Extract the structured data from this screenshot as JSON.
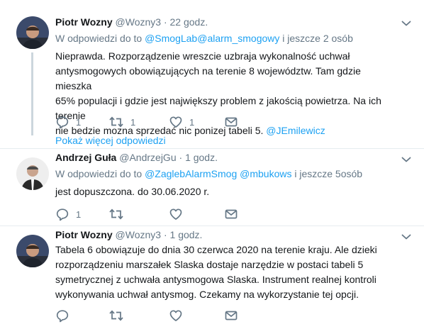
{
  "tweets": [
    {
      "name": "Piotr Wozny",
      "handle": "@Wozny3",
      "sep": "·",
      "time": "22 godz.",
      "reply_prefix": "W odpowiedzi do to ",
      "reply_mention1": "@SmogLab",
      "reply_mention2": "@alarm_smogowy",
      "reply_suffix": " i jeszcze 2 osób",
      "text_line1": "Nieprawda. Rozporządzenie wreszcie uzbraja wykonalność uchwał",
      "text_line2": "antysmogowych obowiązujących na terenie 8 województw. Tam gdzie mieszka",
      "text_line3": "65% populacji i gdzie jest największy problem z jakością powietrza. Na ich terenie",
      "text_line4": "nie bedzie mozna sprzedać nic ponizej tabeli 5. ",
      "text_mention": "@JEmilewicz",
      "reply_count": "1",
      "retweet_count": "1",
      "like_count": "1"
    },
    {
      "name": "Andrzej Guła",
      "handle": "@AndrzejGu",
      "sep": "·",
      "time": "1 godz.",
      "reply_prefix": "W odpowiedzi do to ",
      "reply_mention1": "@ZaglebAlarmSmog",
      "reply_mention2": " @mbukows",
      "reply_suffix": " i jeszcze 5osób",
      "text_line1": "jest dopuszczona. do 30.06.2020 r.",
      "reply_count": "1"
    },
    {
      "name": "Piotr Wozny",
      "handle": "@Wozny3",
      "sep": "·",
      "time": "1 godz.",
      "text_line1": "Tabela 6 obowiązuje do dnia 30 czerwca 2020 na terenie kraju. Ale dzieki",
      "text_line2": "rozporządzeniu marszałek Slaska dostaje narzędzie w postaci tabeli 5",
      "text_line3": "symetrycznej z uchwała antysmogowa Slaska. Instrument realnej kontroli",
      "text_line4": "wykonywania uchwał antysmog. Czekamy na wykorzystanie tej opcji."
    }
  ],
  "show_more": "Pokaż więcej odpowiedzi",
  "icons": [
    "reply-icon",
    "retweet-icon",
    "like-icon",
    "direct-message-icon",
    "chevron-down-icon"
  ],
  "colors": {
    "link": "#1da1f2",
    "muted": "#657786",
    "text": "#14171a",
    "thread_line": "#ccd6dd"
  }
}
